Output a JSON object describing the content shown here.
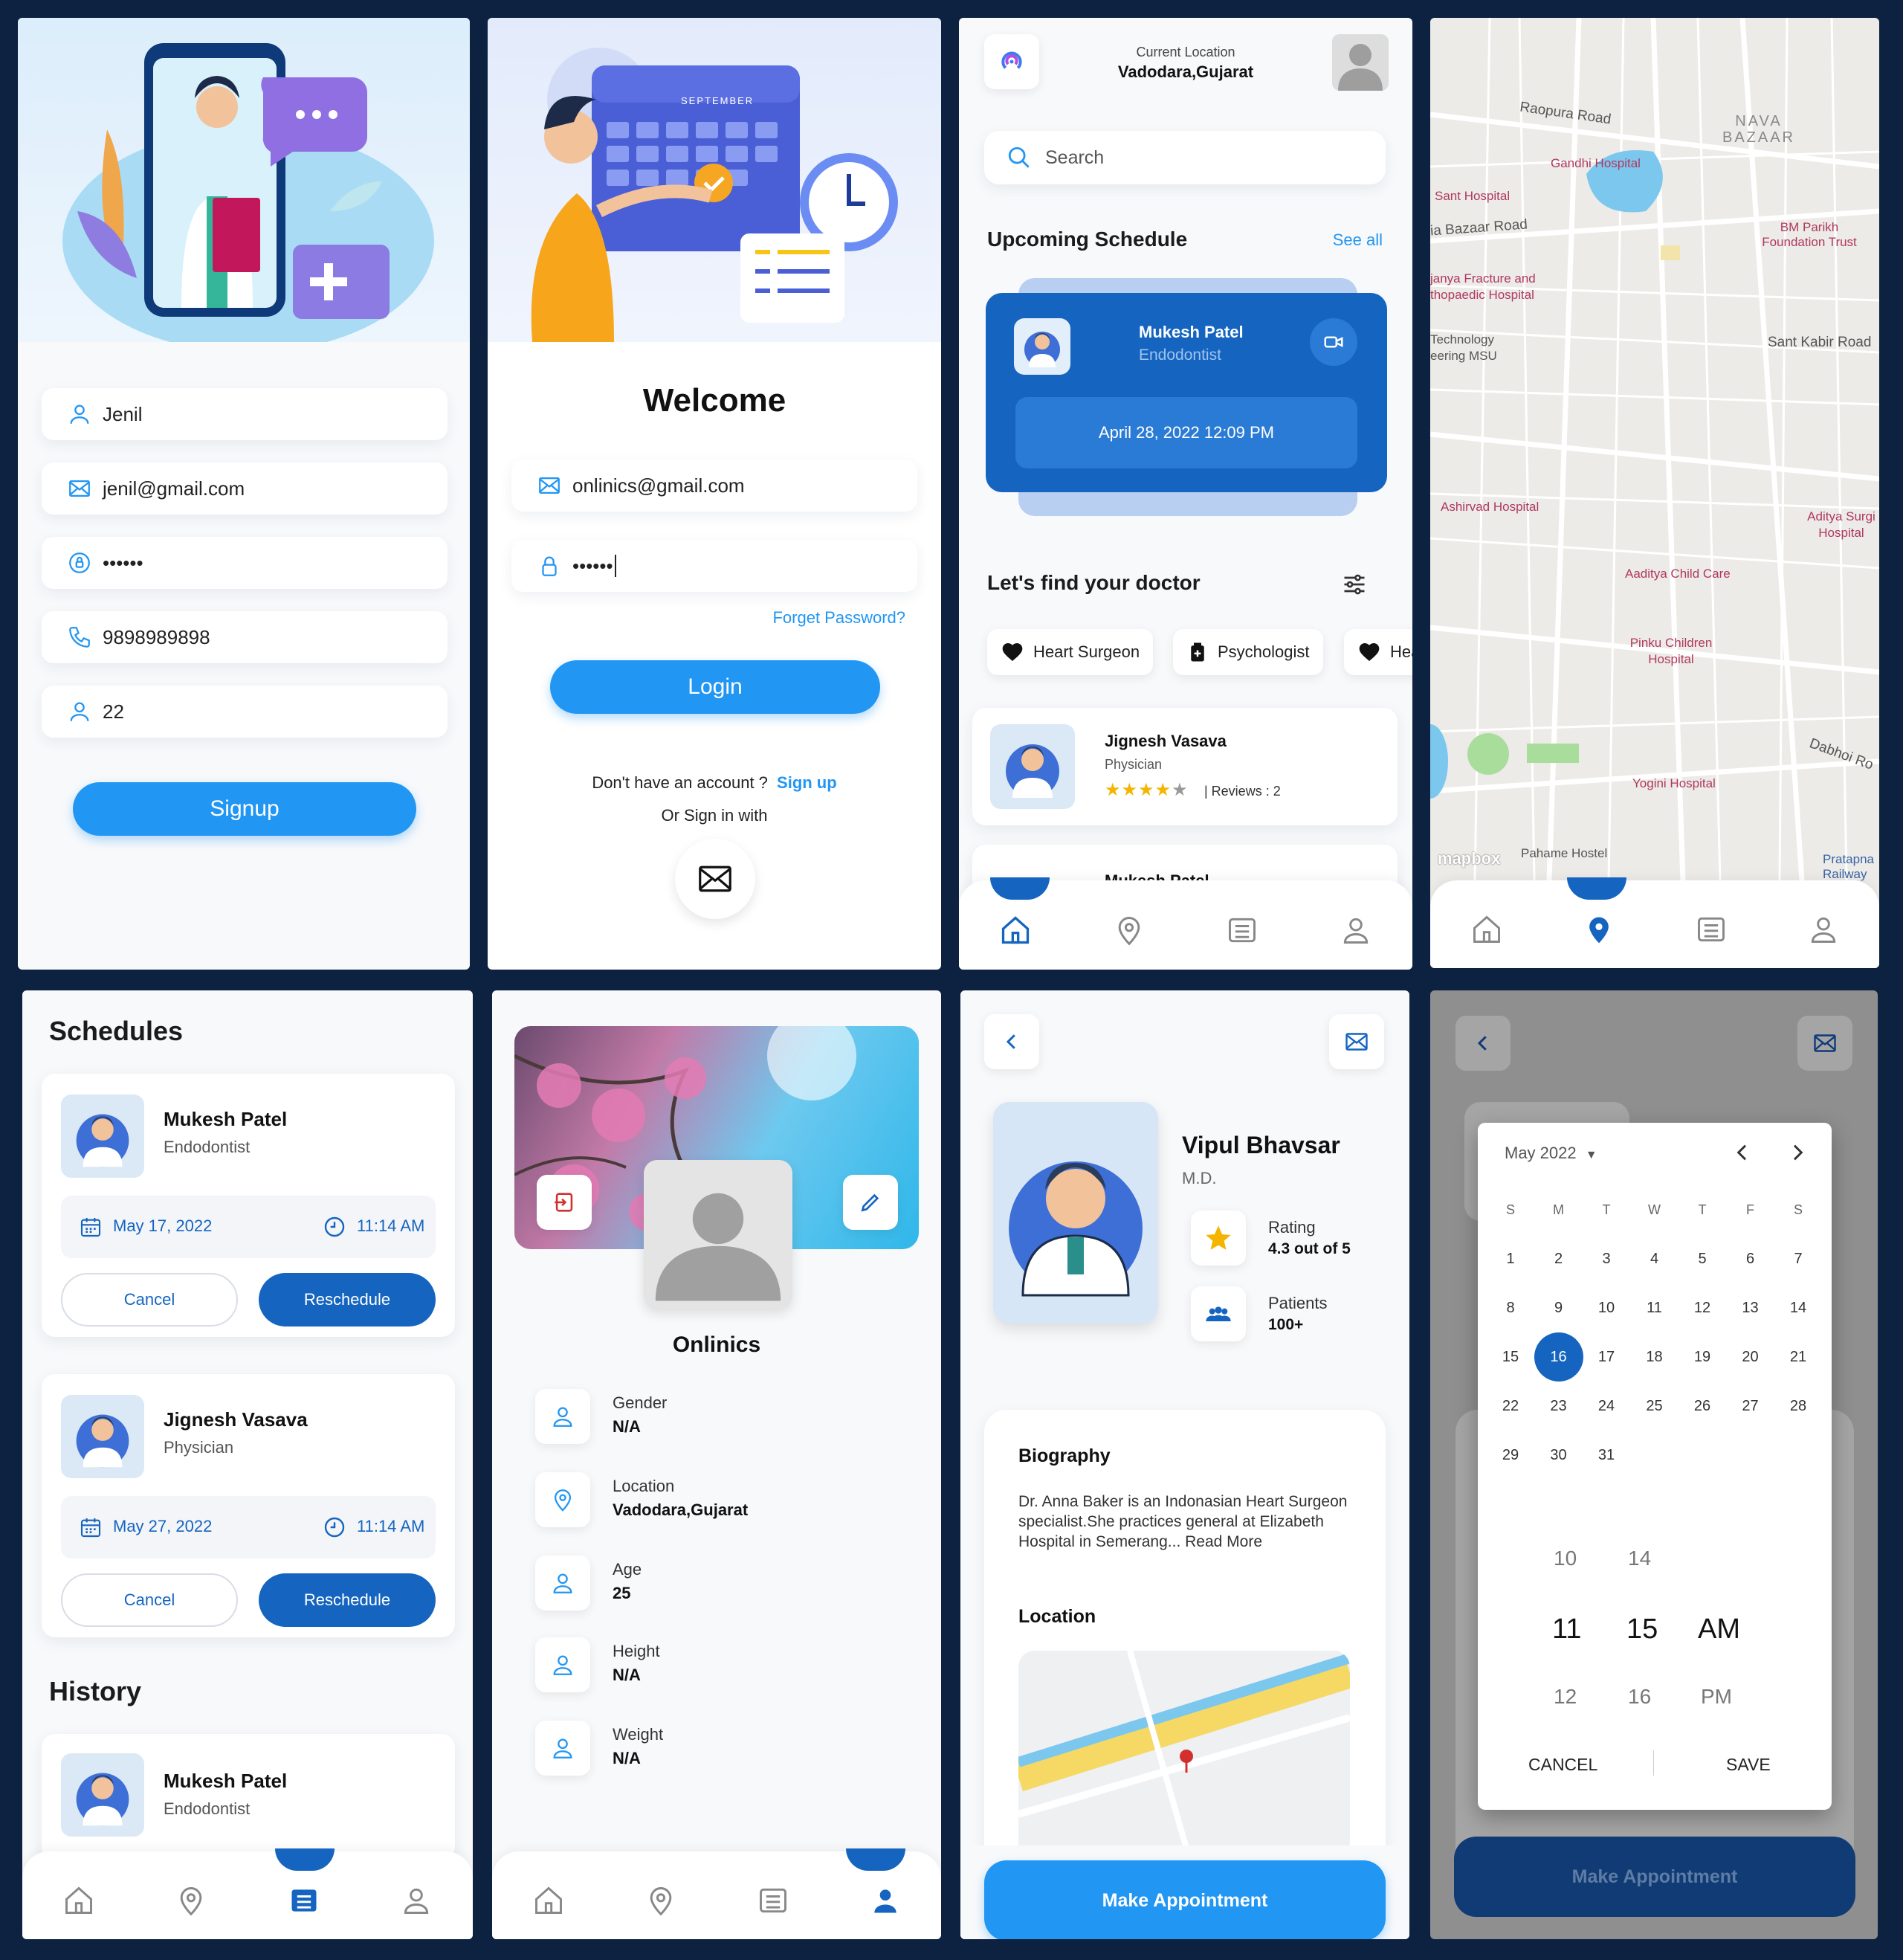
{
  "signup": {
    "name": "Jenil",
    "email": "jenil@gmail.com",
    "password": "••••••",
    "phone": "9898989898",
    "age": "22",
    "button": "Signup"
  },
  "login": {
    "calendar_month": "SEPTEMBER",
    "title": "Welcome",
    "email": "onlinics@gmail.com",
    "password": "••••••",
    "forgot": "Forget Password?",
    "button": "Login",
    "no_account": "Don't have an account ?",
    "signup_link": "Sign up",
    "or_sign_in": "Or Sign in with"
  },
  "home": {
    "location_label": "Current Location",
    "location_value": "Vadodara,Gujarat",
    "search_placeholder": "Search",
    "upcoming_title": "Upcoming Schedule",
    "see_all": "See all",
    "schedule": {
      "name": "Mukesh Patel",
      "role": "Endodontist",
      "datetime": "April 28, 2022 12:09 PM"
    },
    "find_title": "Let's find your doctor",
    "chips": [
      "Heart Surgeon",
      "Psychologist",
      "Heart Surgeon"
    ],
    "doctor": {
      "name": "Jignesh Vasava",
      "role": "Physician",
      "reviews": "| Reviews : 2",
      "rating": 4
    },
    "doctor2_name": "Mukesh Patel"
  },
  "map": {
    "labels": [
      "Raopura Road",
      "NAVA BAZAAR",
      "Gandhi Hospital",
      "Sant Hospital",
      "ia Bazaar Road",
      "BM Parikh Foundation Trust",
      "janya Fracture and thopaedic Hospital",
      "Technology eering MSU",
      "Sant Kabir Road",
      "Ashirvad Hospital",
      "Aditya Surgi Hospital",
      "Aaditya Child Care",
      "Pinku Children Hospital",
      "Dabhoi Ro",
      "Yogini Hospital",
      "Pahame Hostel",
      "Pratapna Railway St",
      "mapbox"
    ]
  },
  "schedules": {
    "title": "Schedules",
    "items": [
      {
        "name": "Mukesh Patel",
        "role": "Endodontist",
        "date": "May 17, 2022",
        "time": "11:14 AM",
        "cancel": "Cancel",
        "reschedule": "Reschedule"
      },
      {
        "name": "Jignesh Vasava",
        "role": "Physician",
        "date": "May 27, 2022",
        "time": "11:14 AM",
        "cancel": "Cancel",
        "reschedule": "Reschedule"
      }
    ],
    "history_title": "History",
    "history": {
      "name": "Mukesh Patel",
      "role": "Endodontist"
    }
  },
  "profile": {
    "name": "Onlinics",
    "fields": [
      {
        "label": "Gender",
        "value": "N/A"
      },
      {
        "label": "Location",
        "value": "Vadodara,Gujarat"
      },
      {
        "label": "Age",
        "value": "25"
      },
      {
        "label": "Height",
        "value": "N/A"
      },
      {
        "label": "Weight",
        "value": "N/A"
      }
    ]
  },
  "doctor_detail": {
    "name": "Vipul Bhavsar",
    "degree": "M.D.",
    "rating_label": "Rating",
    "rating_value": "4.3 out of 5",
    "patients_label": "Patients",
    "patients_value": "100+",
    "bio_title": "Biography",
    "bio": "Dr. Anna Baker is an Indonasian Heart Surgeon specialist.She practices general at Elizabeth Hospital in Semerang... Read More",
    "location_title": "Location",
    "button": "Make Appointment"
  },
  "datepicker": {
    "month": "May 2022",
    "weekdays": [
      "S",
      "M",
      "T",
      "W",
      "T",
      "F",
      "S"
    ],
    "days": [
      "1",
      "2",
      "3",
      "4",
      "5",
      "6",
      "7",
      "8",
      "9",
      "10",
      "11",
      "12",
      "13",
      "14",
      "15",
      "16",
      "17",
      "18",
      "19",
      "20",
      "21",
      "22",
      "23",
      "24",
      "25",
      "26",
      "27",
      "28",
      "29",
      "30",
      "31"
    ],
    "selected": "16",
    "hours": [
      "10",
      "11",
      "12"
    ],
    "minutes": [
      "14",
      "15",
      "16"
    ],
    "ampm": [
      "AM",
      "PM"
    ],
    "cancel": "CANCEL",
    "save": "SAVE",
    "button": "Make Appointment"
  },
  "colors": {
    "primary": "#2196f3",
    "dark": "#1565c0",
    "bg": "#0c2240"
  }
}
